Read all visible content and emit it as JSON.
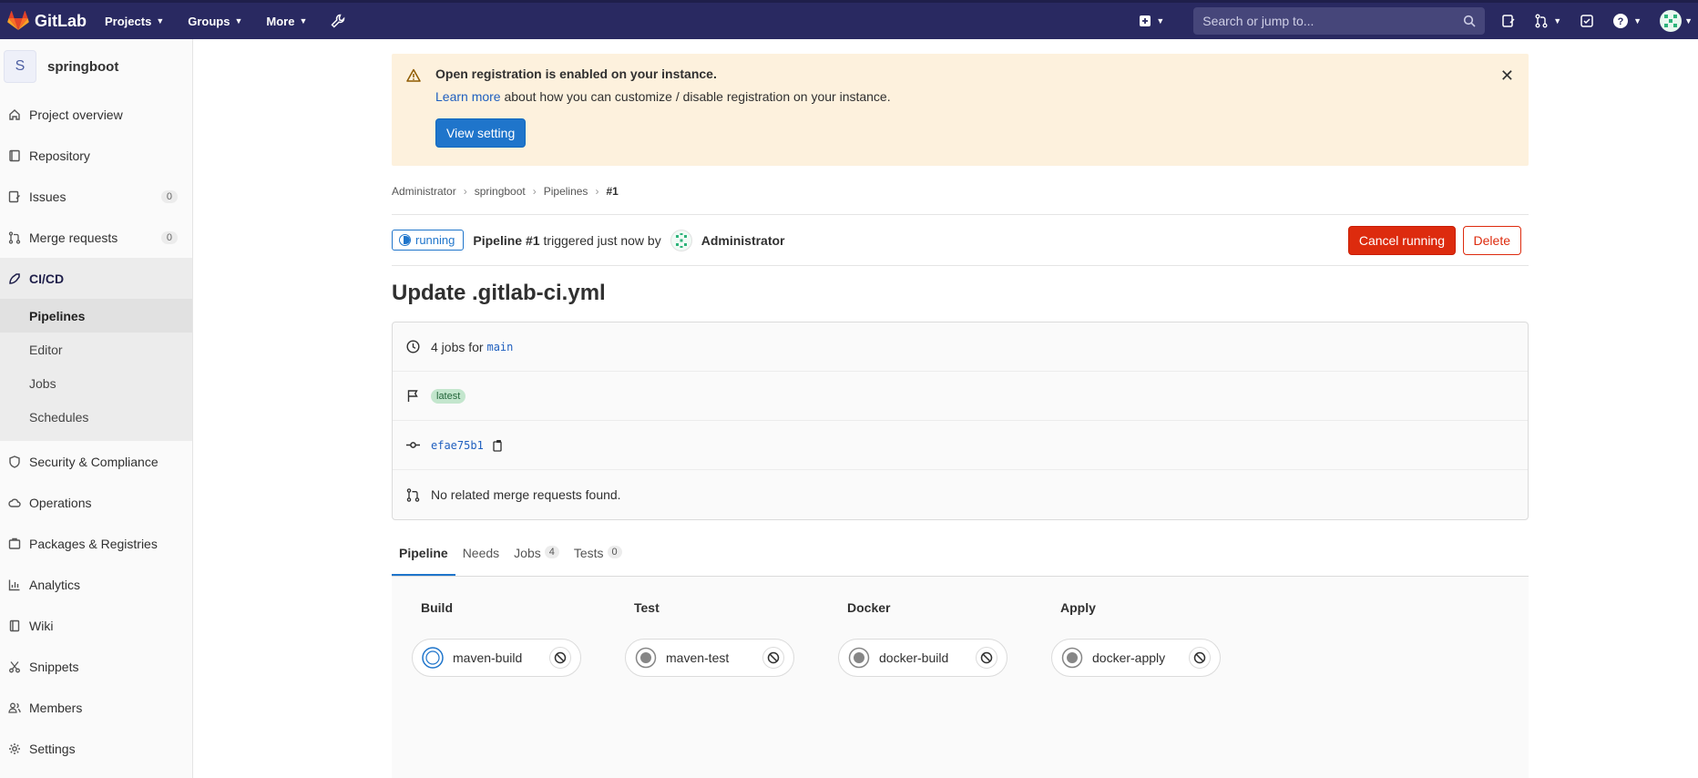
{
  "topnav": {
    "brand": "GitLab",
    "menus": [
      "Projects",
      "Groups",
      "More"
    ],
    "search_placeholder": "Search or jump to..."
  },
  "sidebar": {
    "project_initial": "S",
    "project_name": "springboot",
    "items": [
      {
        "label": "Project overview",
        "icon": "home-icon"
      },
      {
        "label": "Repository",
        "icon": "book-icon"
      },
      {
        "label": "Issues",
        "icon": "issues-icon",
        "count": "0"
      },
      {
        "label": "Merge requests",
        "icon": "merge-request-icon",
        "count": "0"
      },
      {
        "label": "CI/CD",
        "icon": "rocket-icon"
      },
      {
        "label": "Security & Compliance",
        "icon": "shield-icon"
      },
      {
        "label": "Operations",
        "icon": "cloud-icon"
      },
      {
        "label": "Packages & Registries",
        "icon": "package-icon"
      },
      {
        "label": "Analytics",
        "icon": "chart-icon"
      },
      {
        "label": "Wiki",
        "icon": "book-open-icon"
      },
      {
        "label": "Snippets",
        "icon": "scissors-icon"
      },
      {
        "label": "Members",
        "icon": "users-icon"
      },
      {
        "label": "Settings",
        "icon": "gear-icon"
      }
    ],
    "cicd_sub": [
      "Pipelines",
      "Editor",
      "Jobs",
      "Schedules"
    ]
  },
  "alert": {
    "title": "Open registration is enabled on your instance.",
    "link": "Learn more",
    "body": " about how you can customize / disable registration on your instance.",
    "button": "View setting"
  },
  "breadcrumb": [
    "Administrator",
    "springboot",
    "Pipelines",
    "#1"
  ],
  "pipeline": {
    "status": "running",
    "label": "Pipeline #1",
    "triggered": "triggered just now by",
    "user": "Administrator",
    "cancel": "Cancel running",
    "delete": "Delete",
    "title": "Update .gitlab-ci.yml",
    "jobs_text": "4 jobs for",
    "branch": "main",
    "tag": "latest",
    "commit": "efae75b1",
    "mr_text": "No related merge requests found."
  },
  "tabs": [
    {
      "label": "Pipeline"
    },
    {
      "label": "Needs"
    },
    {
      "label": "Jobs",
      "count": "4"
    },
    {
      "label": "Tests",
      "count": "0"
    }
  ],
  "stages": [
    {
      "name": "Build",
      "job": "maven-build",
      "status": "running"
    },
    {
      "name": "Test",
      "job": "maven-test",
      "status": "created"
    },
    {
      "name": "Docker",
      "job": "docker-build",
      "status": "created"
    },
    {
      "name": "Apply",
      "job": "docker-apply",
      "status": "created"
    }
  ],
  "colors": {
    "nav": "#292961",
    "primary": "#1f75cb",
    "danger": "#dd2b0e",
    "alert_bg": "#fdf1dd"
  }
}
